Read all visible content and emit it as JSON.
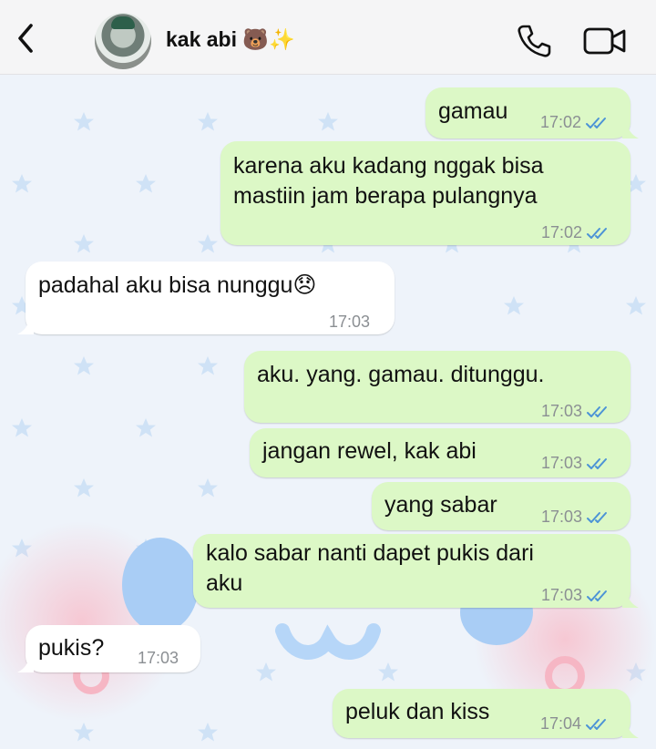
{
  "header": {
    "contact_name": "kak abi 🐻✨",
    "back_icon": "chevron-left-icon",
    "call_icon": "phone-icon",
    "video_icon": "video-camera-icon"
  },
  "colors": {
    "outgoing_bubble": "#dcf8c6",
    "incoming_bubble": "#ffffff",
    "read_ticks": "#4c93d6",
    "wallpaper": "#eef3fa"
  },
  "messages": [
    {
      "dir": "out",
      "text": "gamau",
      "time": "17:02",
      "status": "read"
    },
    {
      "dir": "out",
      "text": "karena aku kadang nggak bisa\nmastiin jam berapa pulangnya",
      "time": "17:02",
      "status": "read"
    },
    {
      "dir": "in",
      "text": "padahal aku bisa nunggu😞",
      "time": "17:03"
    },
    {
      "dir": "out",
      "text": "aku. yang. gamau. ditunggu.",
      "time": "17:03",
      "status": "read"
    },
    {
      "dir": "out",
      "text": "jangan rewel, kak abi",
      "time": "17:03",
      "status": "read"
    },
    {
      "dir": "out",
      "text": "yang sabar",
      "time": "17:03",
      "status": "read"
    },
    {
      "dir": "out",
      "text": "kalo sabar nanti dapet pukis dari\naku",
      "time": "17:03",
      "status": "read"
    },
    {
      "dir": "in",
      "text": "pukis?",
      "time": "17:03"
    },
    {
      "dir": "out",
      "text": "peluk dan kiss",
      "time": "17:04",
      "status": "read"
    }
  ]
}
